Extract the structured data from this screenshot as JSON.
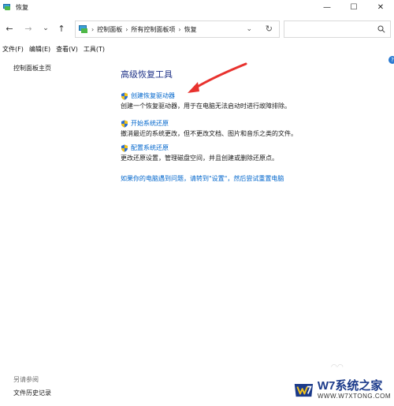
{
  "window": {
    "title": "恢复",
    "controls": {
      "minimize": "—",
      "maximize": "☐",
      "close": "✕"
    }
  },
  "nav": {
    "back": "←",
    "forward": "→",
    "recent": "⌄",
    "up": "↑",
    "breadcrumbs": [
      "控制面板",
      "所有控制面板项",
      "恢复"
    ],
    "dropdown": "⌄",
    "refresh": "↻",
    "search_placeholder": ""
  },
  "menu": [
    "文件(F)",
    "编辑(E)",
    "查看(V)",
    "工具(T)"
  ],
  "sidebar": {
    "home_link": "控制面板主页",
    "see_also_label": "另请参阅",
    "see_also_link": "文件历史记录"
  },
  "main": {
    "title": "高级恢复工具",
    "tasks": [
      {
        "link": "创建恢复驱动器",
        "desc": "创建一个恢复驱动器，用于在电脑无法启动时进行故障排除。"
      },
      {
        "link": "开始系统还原",
        "desc": "撤消最近的系统更改，但不更改文档、图片和音乐之类的文件。"
      },
      {
        "link": "配置系统还原",
        "desc": "更改还原设置，管理磁盘空间，并且创建或删除还原点。"
      }
    ],
    "settings_link": "如果你的电脑遇到问题，请转到\"设置\"，然后尝试重置电脑"
  },
  "help": "?",
  "colors": {
    "link": "#0066cc",
    "title": "#1e3287",
    "annotation_arrow": "#e8322e"
  },
  "watermark": {
    "main": "W7系统之家",
    "sub": "WWW.W7XTONG.COM"
  }
}
